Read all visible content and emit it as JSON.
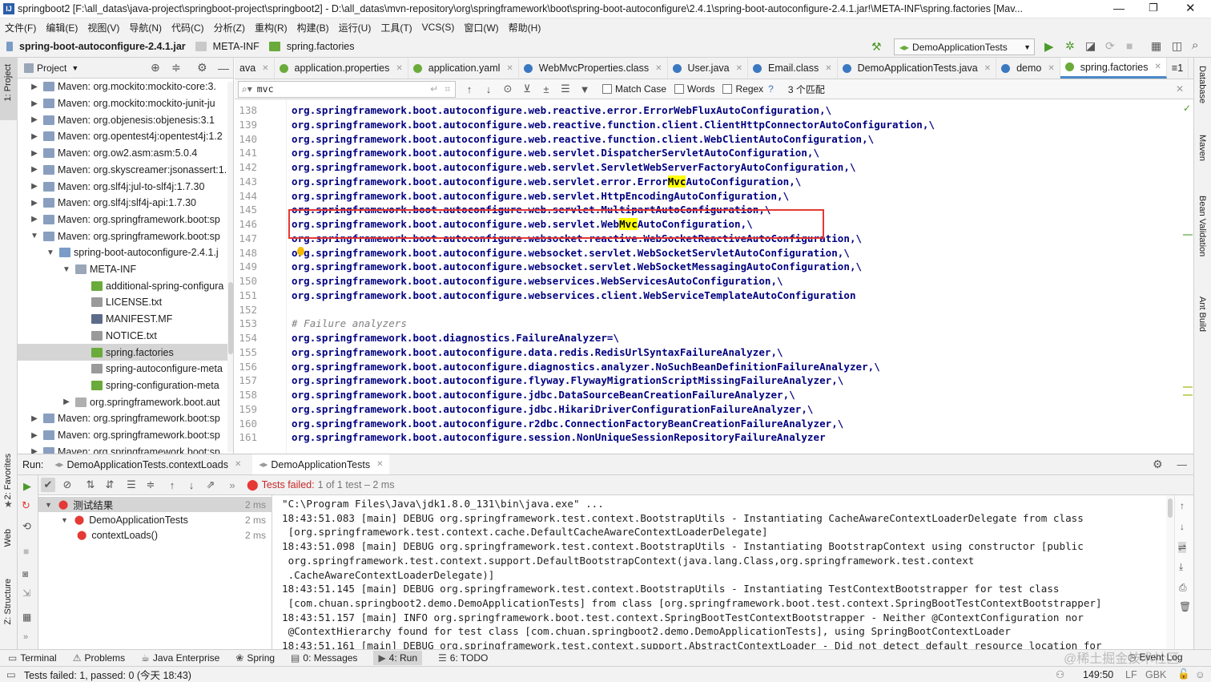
{
  "window": {
    "title": "springboot2 [F:\\all_datas\\java-project\\springboot-project\\springboot2] - D:\\all_datas\\mvn-repository\\org\\springframework\\boot\\spring-boot-autoconfigure\\2.4.1\\spring-boot-autoconfigure-2.4.1.jar!\\META-INF\\spring.factories [Mav..."
  },
  "menu": [
    "文件(F)",
    "编辑(E)",
    "视图(V)",
    "导航(N)",
    "代码(C)",
    "分析(Z)",
    "重构(R)",
    "构建(B)",
    "运行(U)",
    "工具(T)",
    "VCS(S)",
    "窗口(W)",
    "帮助(H)"
  ],
  "breadcrumb": {
    "jar": "spring-boot-autoconfigure-2.4.1.jar",
    "folder": "META-INF",
    "file": "spring.factories"
  },
  "run_config": "DemoApplicationTests",
  "left_strip": {
    "project": "1: Project",
    "favorites": "2: Favorites",
    "web": "Web",
    "structure": "Z: Structure"
  },
  "right_strip": {
    "database": "Database",
    "maven": "Maven",
    "bean": "Bean Validation",
    "ant": "Ant Build"
  },
  "project_panel": {
    "title": "Project",
    "items": [
      {
        "label": "Maven: org.mockito:mockito-core:3.",
        "depth": 0,
        "arrow": "▶",
        "kind": "lib"
      },
      {
        "label": "Maven: org.mockito:mockito-junit-ju",
        "depth": 0,
        "arrow": "▶",
        "kind": "lib"
      },
      {
        "label": "Maven: org.objenesis:objenesis:3.1",
        "depth": 0,
        "arrow": "▶",
        "kind": "lib"
      },
      {
        "label": "Maven: org.opentest4j:opentest4j:1.2",
        "depth": 0,
        "arrow": "▶",
        "kind": "lib"
      },
      {
        "label": "Maven: org.ow2.asm:asm:5.0.4",
        "depth": 0,
        "arrow": "▶",
        "kind": "lib"
      },
      {
        "label": "Maven: org.skyscreamer:jsonassert:1.",
        "depth": 0,
        "arrow": "▶",
        "kind": "lib"
      },
      {
        "label": "Maven: org.slf4j:jul-to-slf4j:1.7.30",
        "depth": 0,
        "arrow": "▶",
        "kind": "lib"
      },
      {
        "label": "Maven: org.slf4j:slf4j-api:1.7.30",
        "depth": 0,
        "arrow": "▶",
        "kind": "lib"
      },
      {
        "label": "Maven: org.springframework.boot:sp",
        "depth": 0,
        "arrow": "▶",
        "kind": "lib"
      },
      {
        "label": "Maven: org.springframework.boot:sp",
        "depth": 0,
        "arrow": "▼",
        "kind": "lib"
      },
      {
        "label": "spring-boot-autoconfigure-2.4.1.j",
        "depth": 1,
        "arrow": "▼",
        "kind": "jar"
      },
      {
        "label": "META-INF",
        "depth": 2,
        "arrow": "▼",
        "kind": "folder"
      },
      {
        "label": "additional-spring-configura",
        "depth": 3,
        "arrow": "",
        "kind": "json"
      },
      {
        "label": "LICENSE.txt",
        "depth": 3,
        "arrow": "",
        "kind": "txt"
      },
      {
        "label": "MANIFEST.MF",
        "depth": 3,
        "arrow": "",
        "kind": "mf"
      },
      {
        "label": "NOTICE.txt",
        "depth": 3,
        "arrow": "",
        "kind": "txt"
      },
      {
        "label": "spring.factories",
        "depth": 3,
        "arrow": "",
        "kind": "spring",
        "selected": true
      },
      {
        "label": "spring-autoconfigure-meta",
        "depth": 3,
        "arrow": "",
        "kind": "txt"
      },
      {
        "label": "spring-configuration-meta",
        "depth": 3,
        "arrow": "",
        "kind": "json"
      },
      {
        "label": "org.springframework.boot.aut",
        "depth": 2,
        "arrow": "▶",
        "kind": "pkg"
      },
      {
        "label": "Maven: org.springframework.boot:sp",
        "depth": 0,
        "arrow": "▶",
        "kind": "lib"
      },
      {
        "label": "Maven: org.springframework.boot:sp",
        "depth": 0,
        "arrow": "▶",
        "kind": "lib"
      },
      {
        "label": "Maven: org.springframework.boot:sp",
        "depth": 0,
        "arrow": "▶",
        "kind": "lib"
      }
    ]
  },
  "tabs": [
    {
      "label": "ava",
      "icon": ""
    },
    {
      "label": "application.properties",
      "icon": "leaf"
    },
    {
      "label": "application.yaml",
      "icon": "leaf"
    },
    {
      "label": "WebMvcProperties.class",
      "icon": "class"
    },
    {
      "label": "User.java",
      "icon": "class"
    },
    {
      "label": "Email.class",
      "icon": "class"
    },
    {
      "label": "DemoApplicationTests.java",
      "icon": "class"
    },
    {
      "label": "demo",
      "icon": "m"
    },
    {
      "label": "spring.factories",
      "icon": "leaf",
      "active": true
    }
  ],
  "tabs_overflow": "≡1",
  "search": {
    "query": "mvc",
    "match_case": "Match Case",
    "words": "Words",
    "regex": "Regex",
    "help": "?",
    "result": "3 个匹配"
  },
  "code": [
    {
      "n": "138",
      "text": "org.springframework.boot.autoconfigure.web.reactive.error.ErrorWebFluxAutoConfiguration,\\"
    },
    {
      "n": "139",
      "text": "org.springframework.boot.autoconfigure.web.reactive.function.client.ClientHttpConnectorAutoConfiguration,\\"
    },
    {
      "n": "140",
      "text": "org.springframework.boot.autoconfigure.web.reactive.function.client.WebClientAutoConfiguration,\\"
    },
    {
      "n": "141",
      "text": "org.springframework.boot.autoconfigure.web.servlet.DispatcherServletAutoConfiguration,\\"
    },
    {
      "n": "142",
      "text": "org.springframework.boot.autoconfigure.web.servlet.ServletWebServerFactoryAutoConfiguration,\\"
    },
    {
      "n": "143",
      "pre": "org.springframework.boot.autoconfigure.web.servlet.error.Error",
      "match": "Mvc",
      "post": "AutoConfiguration,\\"
    },
    {
      "n": "144",
      "text": "org.springframework.boot.autoconfigure.web.servlet.HttpEncodingAutoConfiguration,\\"
    },
    {
      "n": "145",
      "text": "org.springframework.boot.autoconfigure.web.servlet.MultipartAutoConfiguration,\\"
    },
    {
      "n": "146",
      "pre": "org.springframework.boot.autoconfigure.web.servlet.Web",
      "match": "Mvc",
      "post": "AutoConfiguration,\\"
    },
    {
      "n": "147",
      "text": "org.springframework.boot.autoconfigure.websocket.reactive.WebSocketReactiveAutoConfiguration,\\"
    },
    {
      "n": "148",
      "text": "org.springframework.boot.autoconfigure.websocket.servlet.WebSocketServletAutoConfiguration,\\"
    },
    {
      "n": "149",
      "text": "org.springframework.boot.autoconfigure.websocket.servlet.WebSocketMessagingAutoConfiguration,\\"
    },
    {
      "n": "150",
      "text": "org.springframework.boot.autoconfigure.webservices.WebServicesAutoConfiguration,\\"
    },
    {
      "n": "151",
      "text": "org.springframework.boot.autoconfigure.webservices.client.WebServiceTemplateAutoConfiguration"
    },
    {
      "n": "152",
      "text": ""
    },
    {
      "n": "153",
      "text": "# Failure analyzers",
      "comment": true
    },
    {
      "n": "154",
      "text": "org.springframework.boot.diagnostics.FailureAnalyzer=\\"
    },
    {
      "n": "155",
      "text": "org.springframework.boot.autoconfigure.data.redis.RedisUrlSyntaxFailureAnalyzer,\\"
    },
    {
      "n": "156",
      "text": "org.springframework.boot.autoconfigure.diagnostics.analyzer.NoSuchBeanDefinitionFailureAnalyzer,\\"
    },
    {
      "n": "157",
      "text": "org.springframework.boot.autoconfigure.flyway.FlywayMigrationScriptMissingFailureAnalyzer,\\"
    },
    {
      "n": "158",
      "text": "org.springframework.boot.autoconfigure.jdbc.DataSourceBeanCreationFailureAnalyzer,\\"
    },
    {
      "n": "159",
      "text": "org.springframework.boot.autoconfigure.jdbc.HikariDriverConfigurationFailureAnalyzer,\\"
    },
    {
      "n": "160",
      "text": "org.springframework.boot.autoconfigure.r2dbc.ConnectionFactoryBeanCreationFailureAnalyzer,\\"
    },
    {
      "n": "161",
      "text": "org.springframework.boot.autoconfigure.session.NonUniqueSessionRepositoryFailureAnalyzer"
    }
  ],
  "run_panel": {
    "label": "Run:",
    "tabs": [
      "DemoApplicationTests.contextLoads",
      "DemoApplicationTests"
    ],
    "status": "Tests failed:",
    "status_detail": "1 of 1 test – 2 ms",
    "tree": [
      {
        "label": "测试结果",
        "time": "2 ms",
        "depth": 0
      },
      {
        "label": "DemoApplicationTests",
        "time": "2 ms",
        "depth": 1
      },
      {
        "label": "contextLoads()",
        "time": "2 ms",
        "depth": 2
      }
    ],
    "console": [
      "\"C:\\Program Files\\Java\\jdk1.8.0_131\\bin\\java.exe\" ...",
      "18:43:51.083 [main] DEBUG org.springframework.test.context.BootstrapUtils - Instantiating CacheAwareContextLoaderDelegate from class",
      " [org.springframework.test.context.cache.DefaultCacheAwareContextLoaderDelegate]",
      "18:43:51.098 [main] DEBUG org.springframework.test.context.BootstrapUtils - Instantiating BootstrapContext using constructor [public",
      " org.springframework.test.context.support.DefaultBootstrapContext(java.lang.Class,org.springframework.test.context",
      " .CacheAwareContextLoaderDelegate)]",
      "18:43:51.145 [main] DEBUG org.springframework.test.context.BootstrapUtils - Instantiating TestContextBootstrapper for test class",
      " [com.chuan.springboot2.demo.DemoApplicationTests] from class [org.springframework.boot.test.context.SpringBootTestContextBootstrapper]",
      "18:43:51.157 [main] INFO org.springframework.boot.test.context.SpringBootTestContextBootstrapper - Neither @ContextConfiguration nor",
      " @ContextHierarchy found for test class [com.chuan.springboot2.demo.DemoApplicationTests], using SpringBootContextLoader",
      "18:43:51.161 [main] DEBUG org.springframework.test.context.support.AbstractContextLoader - Did not detect default resource location for"
    ]
  },
  "tool_windows": [
    {
      "label": "Terminal",
      "icon": "▭"
    },
    {
      "label": "Problems",
      "icon": "⚠"
    },
    {
      "label": "Java Enterprise",
      "icon": "☕"
    },
    {
      "label": "Spring",
      "icon": "❀"
    },
    {
      "label": "0: Messages",
      "icon": "▤"
    },
    {
      "label": "4: Run",
      "icon": "▶",
      "active": true
    },
    {
      "label": "6: TODO",
      "icon": "☰"
    }
  ],
  "event_log": "Event Log",
  "status": {
    "message": "Tests failed: 1, passed: 0 (今天 18:43)",
    "position": "149:50",
    "line_sep": "LF",
    "encoding": "GBK",
    "watermark": "@稀土掘金技术社区"
  },
  "colors": {
    "match": "#ffff00",
    "keyword": "#000080",
    "error": "#e53935",
    "red_box": "#e53935",
    "accent": "#4a88c7"
  }
}
